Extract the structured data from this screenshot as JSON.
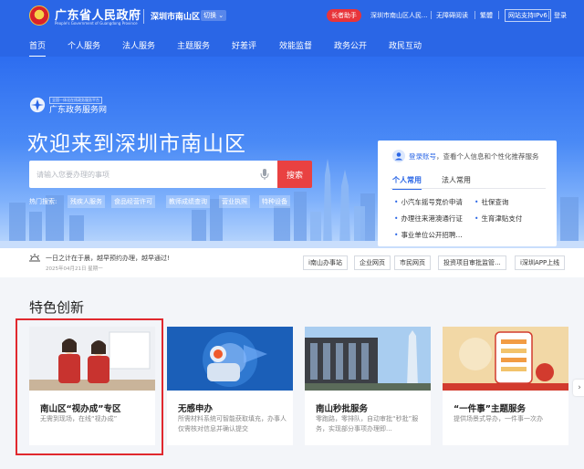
{
  "header": {
    "site_title": "广东省人民政府",
    "site_subtitle": "People's Government of Guangdong Province",
    "city": "深圳市南山区",
    "switch_label": "切换",
    "elder_mode": "长者助手",
    "breadcrumb": "深圳市南山区人民...",
    "accessibility": "无障碍阅读",
    "traditional": "繁體",
    "ipv6": "网站支持IPv6",
    "login": "登录"
  },
  "nav": [
    "首页",
    "个人服务",
    "法人服务",
    "主题服务",
    "好差评",
    "效能监督",
    "政务公开",
    "政民互动"
  ],
  "hero": {
    "portal_tag": "全国一体化在线政务服务平台",
    "portal_name": "广东政务服务网",
    "welcome": "欢迎来到深圳市南山区",
    "search_placeholder": "请输入您要办理的事项",
    "search_button": "搜索",
    "hot_label": "热门搜索:",
    "hot_tags": [
      "残疾人服务",
      "食品经营许可",
      "教师成绩查询",
      "营业执照",
      "特种设备"
    ]
  },
  "login_card": {
    "link": "登录账号",
    "text": "，查看个人信息和个性化推荐服务",
    "tabs": [
      "个人常用",
      "法人常用"
    ],
    "services": [
      "小汽车摇号竞价申请",
      "社保查询",
      "办理往来港澳通行证",
      "生育津贴支付",
      "事业单位公开招聘..."
    ]
  },
  "notice": {
    "text": "一日之计在于晨，越早预约办理，越早通过!",
    "date": "2025年04月21日 星期一",
    "buttons": [
      "i南山办事站",
      "企业网页",
      "市民网页",
      "投资项目审批监管...",
      "i深圳APP上线"
    ]
  },
  "features": {
    "title": "特色创新",
    "cards": [
      {
        "title": "南山区“视办成”专区",
        "desc": "无需到现场，在线“视办成”"
      },
      {
        "title": "无感申办",
        "desc": "所需材料系统可智能获取填充，办事人仅需核对信息并确认提交"
      },
      {
        "title": "南山秒批服务",
        "desc": "零跑路，零排队，自动审批“秒批”服务，实现部分事项办理即..."
      },
      {
        "title": "“一件事”主题服务",
        "desc": "提供场景式导办，一件事一次办"
      }
    ],
    "next_arrow": "›"
  },
  "colors": {
    "brand_blue": "#2a66e6",
    "accent_red": "#e94141"
  }
}
